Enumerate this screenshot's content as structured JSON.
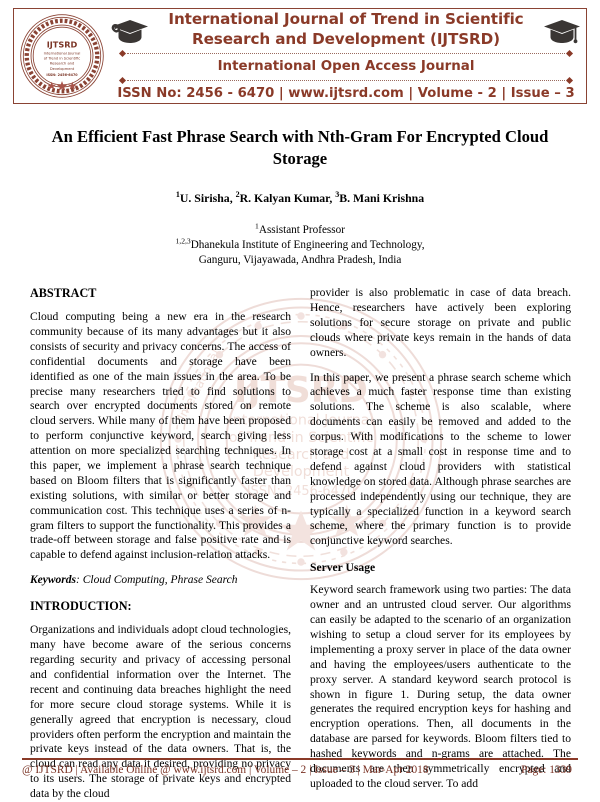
{
  "masthead": {
    "logo_alt": "journal-seal-logo",
    "seal_text": "IJTSRD",
    "seal_sub": "International Journal of Trend in Scientific Research and Development",
    "seal_issn": "ISSN: 2456-6470",
    "title_line1": "International Journal of Trend in Scientific",
    "title_line2": "Research and Development  (IJTSRD)",
    "open_access": "International Open Access Journal",
    "issn_line": "ISSN No: 2456 - 6470  |  www.ijtsrd.com  |  Volume - 2 | Issue – 3",
    "accent_color": "#8a3a28",
    "border_color": "#8a4334"
  },
  "paper": {
    "title": "An Efficient Fast Phrase Search with Nth-Gram For Encrypted Cloud Storage",
    "authors_parts": [
      {
        "sup": "1",
        "name": "U. Sirisha, "
      },
      {
        "sup": "2",
        "name": "R. Kalyan Kumar, "
      },
      {
        "sup": "3",
        "name": "B. Mani Krishna"
      }
    ],
    "affiliation_role_sup": "1",
    "affiliation_role": "Assistant Professor",
    "affiliation_inst_sup": "1,2,3",
    "affiliation_inst": "Dhanekula Institute of Engineering and Technology,",
    "affiliation_place": "Ganguru, Vijayawada, Andhra Pradesh, India"
  },
  "left_column": {
    "abstract_heading": "ABSTRACT",
    "abstract_text": "Cloud computing being a new era in the research community because of its many advantages but it also consists of security and privacy concerns. The access of confidential documents and storage have been identified as one of the main issues in the area. To be precise many researchers tried to find solutions to search over encrypted documents stored on remote cloud servers. While many of them have been proposed to perform conjunctive keyword, search giving less attention on more specialized searching techniques. In this paper, we implement a phrase search technique based on Bloom filters that is significantly faster than existing solutions, with similar or better storage and communication cost. This technique uses a series of n-gram filters to support the functionality. This provides a trade-off between storage and false positive rate and is capable to defend against inclusion-relation attacks.",
    "keywords_label": "Keywords",
    "keywords_value": ": Cloud Computing, Phrase Search",
    "intro_heading": "INTRODUCTION:",
    "intro_text": "Organizations and individuals adopt cloud technologies, many have become aware of the serious concerns regarding security and privacy of accessing personal and confidential information over the Internet. The recent and continuing data breaches highlight the need for more secure cloud storage systems. While it is generally agreed that encryption is necessary, cloud providers often perform the encryption and maintain the private keys instead of the data owners. That is, the cloud can read any data it desired, providing no privacy to its users. The storage of private keys and encrypted data by the cloud"
  },
  "right_column": {
    "para1": "provider is also problematic in case of data breach. Hence, researchers have actively been exploring solutions for secure storage on private and public clouds where private keys remain in the hands of data owners.",
    "para2": "In this paper, we present a phrase search scheme which achieves a much faster response time than existing solutions. The scheme is also scalable, where documents can easily be removed and added to the corpus. With modifications to the scheme to lower storage cost at a small cost in response time and to defend against cloud providers with statistical knowledge on stored data. Although phrase searches are processed independently using our technique, they are typically a specialized function in a keyword search scheme, where the primary function is to provide conjunctive keyword searches.",
    "server_heading": "Server Usage",
    "para3": "Keyword search framework using two parties: The data owner and an untrusted cloud server. Our algorithms can easily be adapted to the scenario of an organization wishing to setup a cloud server for its employees by implementing a proxy server in place of the data owner and having the employees/users authenticate to the proxy server. A standard keyword search protocol is shown in figure 1. During setup, the data owner generates the required encryption keys for hashing and encryption operations. Then, all documents in the database are parsed for keywords. Bloom filters tied to hashed keywords and n-grams are attached. The documents are then symmetrically encrypted and uploaded to the cloud server. To add"
  },
  "footer": {
    "left": "@ IJTSRD  |  Available Online @ www.ijtsrd.com |  Volume – 2  |  Issue – 3  | Mar-Apr 2018",
    "right": "Page: 1339"
  }
}
